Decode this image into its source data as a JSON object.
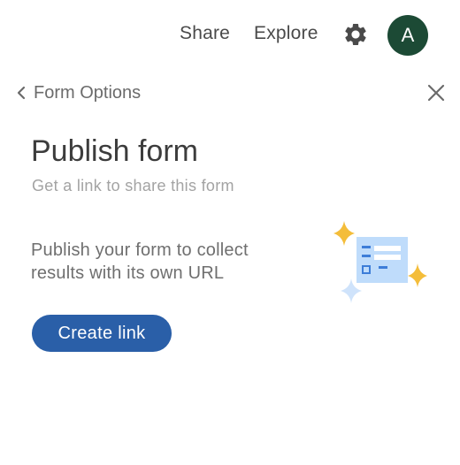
{
  "header": {
    "share_label": "Share",
    "explore_label": "Explore",
    "settings_icon": "gear-icon",
    "avatar_initial": "A",
    "avatar_color": "#1c4a35"
  },
  "panel": {
    "back_label": "Form Options",
    "back_icon": "chevron-left-icon",
    "close_icon": "close-icon",
    "title": "Publish form",
    "subtitle": "Get a link to share this form",
    "description": "Publish your form to collect results with its own URL",
    "illustration_icon": "form-link-illustration",
    "create_link_label": "Create link",
    "accent_color": "#2a5fa8"
  }
}
